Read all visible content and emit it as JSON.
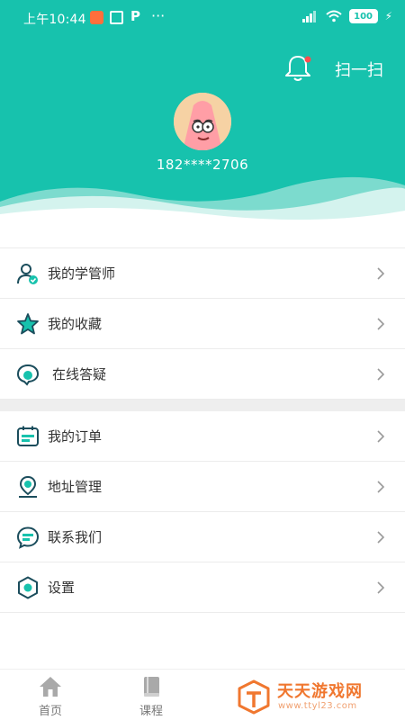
{
  "status_bar": {
    "time": "上午10:44",
    "more": "···",
    "p_label": "P",
    "battery": "100"
  },
  "header": {
    "scan_label": "扫一扫",
    "phone": "182****2706",
    "bell_icon": "bell-icon",
    "notification_dot_color": "#ff4d4f",
    "brand_color": "#17c2ad"
  },
  "menu": {
    "group1": [
      {
        "label": "我的学管师",
        "icon": "advisor-icon"
      },
      {
        "label": "我的收藏",
        "icon": "star-icon"
      },
      {
        "label": "在线答疑",
        "icon": "chat-bubble-icon"
      }
    ],
    "group2": [
      {
        "label": "我的订单",
        "icon": "calendar-icon"
      },
      {
        "label": "地址管理",
        "icon": "location-pin-icon"
      },
      {
        "label": "联系我们",
        "icon": "message-icon"
      },
      {
        "label": "设置",
        "icon": "settings-icon"
      }
    ]
  },
  "bottom_nav": {
    "tabs": [
      {
        "label": "首页",
        "icon": "home-icon"
      },
      {
        "label": "课程",
        "icon": "book-icon"
      }
    ]
  },
  "watermark": {
    "title": "天天游戏网",
    "url": "www.ttyl23.com"
  }
}
